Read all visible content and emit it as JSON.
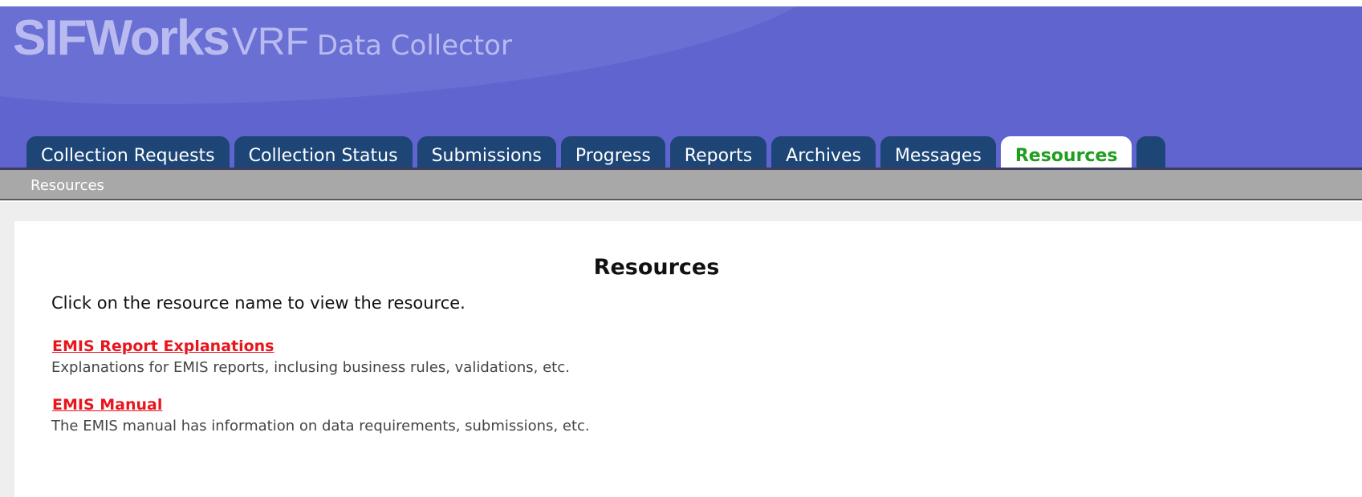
{
  "header": {
    "brand": {
      "part1": "SIFWorks",
      "part2": "VRF",
      "part3": "Data Collector"
    },
    "tabs": [
      {
        "label": "Collection Requests",
        "active": false
      },
      {
        "label": "Collection Status",
        "active": false
      },
      {
        "label": "Submissions",
        "active": false
      },
      {
        "label": "Progress",
        "active": false
      },
      {
        "label": "Reports",
        "active": false
      },
      {
        "label": "Archives",
        "active": false
      },
      {
        "label": "Messages",
        "active": false
      },
      {
        "label": "Resources",
        "active": true
      }
    ]
  },
  "subnav": {
    "items": [
      {
        "label": "Resources"
      }
    ]
  },
  "main": {
    "title": "Resources",
    "intro": "Click on the resource name to view the resource.",
    "resources": [
      {
        "name": "EMIS Report Explanations",
        "description": "Explanations for EMIS reports, inclusing business rules, validations, etc."
      },
      {
        "name": "EMIS Manual",
        "description": "The EMIS manual has information on data requirements, submissions, etc."
      }
    ]
  },
  "colors": {
    "header_bg": "#5f64cf",
    "tab_bg": "#1d4677",
    "active_tab_text": "#1f9e1f",
    "link": "#e8161c",
    "subnav_bg": "#a8a8a8"
  }
}
